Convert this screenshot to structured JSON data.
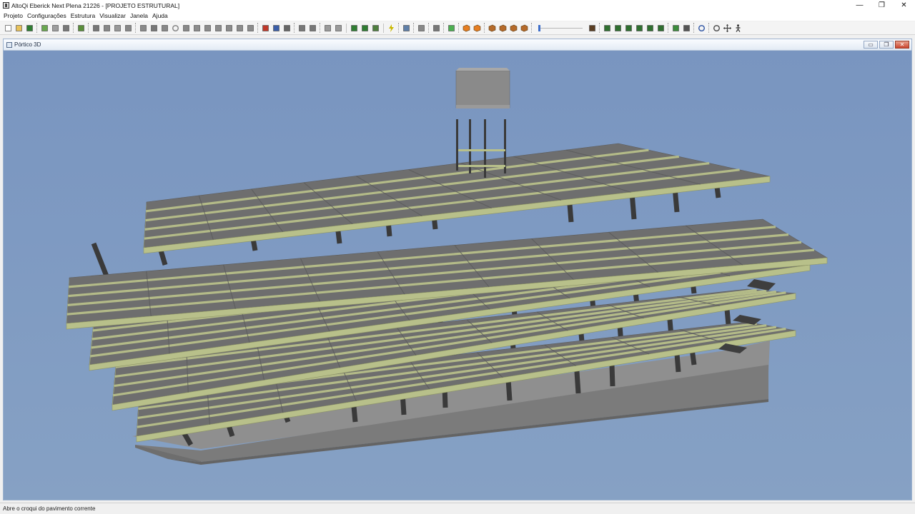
{
  "window": {
    "title": "AltoQi Eberick  Next Plena 21226 - [PROJETO ESTRUTURAL]",
    "controls": {
      "minimize": "—",
      "restore": "❐",
      "close": "✕"
    }
  },
  "menu": {
    "items": [
      "Projeto",
      "Configurações",
      "Estrutura",
      "Visualizar",
      "Janela",
      "Ajuda"
    ]
  },
  "toolbar": {
    "icons": [
      "new-icon",
      "open-icon",
      "save-icon",
      "grip",
      "pencil-icon",
      "copy-icon",
      "print-icon",
      "grip",
      "tree-icon",
      "grip",
      "pillar-icon",
      "beam-icon",
      "slab-icon",
      "wall-icon",
      "grip",
      "stair-icon",
      "foundation-icon",
      "block-icon",
      "circle-icon",
      "hexagon-icon",
      "shape-icon",
      "shape-icon",
      "shape-icon",
      "shape-icon",
      "shape-icon",
      "shape-icon",
      "grip",
      "frame-3d-icon",
      "view-3d-icon",
      "report-icon",
      "grip",
      "arrow-icon",
      "arrow-icon",
      "grip",
      "grid-icon",
      "grid-icon",
      "sep",
      "table-icon",
      "table-icon",
      "chart-icon",
      "sep",
      "lightning-icon",
      "grip",
      "refresh-icon",
      "grip",
      "detail-icon",
      "grip",
      "box-icon",
      "grip",
      "check-icon",
      "grip",
      "cube-orange-icon",
      "cube-orange-icon",
      "grip",
      "cube-icon",
      "cube-icon",
      "cube-icon",
      "cube-icon",
      "grip"
    ],
    "icons_right": [
      "ruler-icon",
      "grip",
      "level-icon",
      "level-icon",
      "level-icon",
      "level-icon",
      "level-icon",
      "level-icon",
      "grip",
      "tree-green-icon",
      "expand-icon",
      "grip",
      "zoom-icon",
      "grip",
      "rotate-icon",
      "pan-icon",
      "walk-icon"
    ]
  },
  "child_window": {
    "title": "Pórtico 3D",
    "controls": {
      "minimize": "▭",
      "restore": "❐",
      "close": "✕"
    }
  },
  "colors": {
    "viewport_bg": "#7e9ac0",
    "slab": "#6e6e6e",
    "beam": "#b8c08a",
    "column": "#3a3a3a",
    "base": "#8a8a8a"
  },
  "status": {
    "text": "Abre o croqui do pavimento corrente"
  }
}
